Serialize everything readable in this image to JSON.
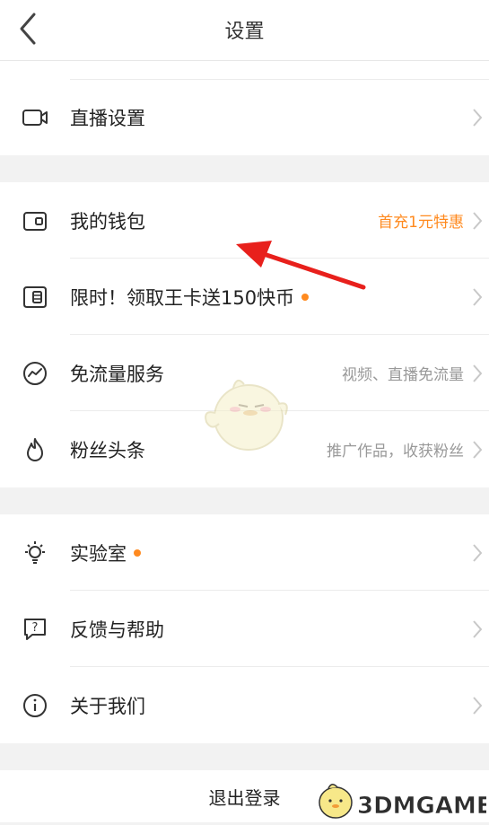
{
  "header": {
    "title": "设置",
    "back_icon": "back-chevron-icon"
  },
  "groups": [
    {
      "items": [
        {
          "name": "live",
          "label": "直播设置",
          "value": "",
          "icon": "camera-icon"
        }
      ]
    },
    {
      "items": [
        {
          "name": "wallet",
          "label": "我的钱包",
          "value": "首充1元特惠",
          "value_color": "#ff8a1f",
          "icon": "wallet-icon"
        },
        {
          "name": "kingcard",
          "label": "限时！领取王卡送150快币",
          "value": "",
          "dot": true,
          "icon": "sim-card-icon"
        },
        {
          "name": "freeflow",
          "label": "免流量服务",
          "value": "视频、直播免流量",
          "icon": "traffic-icon"
        },
        {
          "name": "fans",
          "label": "粉丝头条",
          "value": "推广作品，收获粉丝",
          "icon": "flame-icon"
        }
      ]
    },
    {
      "items": [
        {
          "name": "lab",
          "label": "实验室",
          "value": "",
          "dot": true,
          "icon": "lightbulb-icon"
        },
        {
          "name": "feedback",
          "label": "反馈与帮助",
          "value": "",
          "icon": "help-bubble-icon"
        },
        {
          "name": "about",
          "label": "关于我们",
          "value": "",
          "icon": "info-icon"
        }
      ]
    }
  ],
  "logout": {
    "label": "退出登录"
  },
  "watermark": {
    "text": "3DMGAME"
  },
  "colors": {
    "accent": "#ff8a1f",
    "arrow": "#e8201c"
  }
}
